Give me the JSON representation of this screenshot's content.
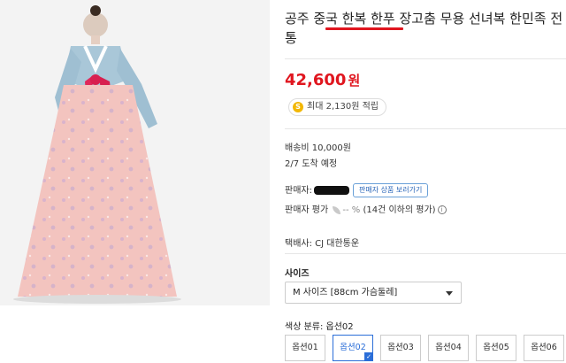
{
  "product": {
    "title": "공주 중국 한복 한푸 장고춤 무용 선녀복 한민족 전통",
    "price": "42,600",
    "price_unit": "원",
    "reward": "최대 2,130원 적립"
  },
  "shipping": {
    "fee": "배송비 10,000원",
    "eta": "2/7 도착 예정"
  },
  "seller": {
    "label": "판매자:",
    "view_button": "판매자 상품 보러가기",
    "rating_label": "판매자 평가",
    "rating_value": "-- %",
    "rating_note": "(14건 이하의 평가)"
  },
  "courier": "택배사: CJ 대한통운",
  "size": {
    "label": "사이즈",
    "selected": "M 사이즈 [88cm 가슴둘레]"
  },
  "color": {
    "label": "색상 분류: 옵션02",
    "options": [
      "옵션01",
      "옵션02",
      "옵션03",
      "옵션04",
      "옵션05",
      "옵션06"
    ],
    "selected_index": 1
  },
  "colors": {
    "accent": "#e0161f",
    "select_blue": "#2b6ed8"
  }
}
